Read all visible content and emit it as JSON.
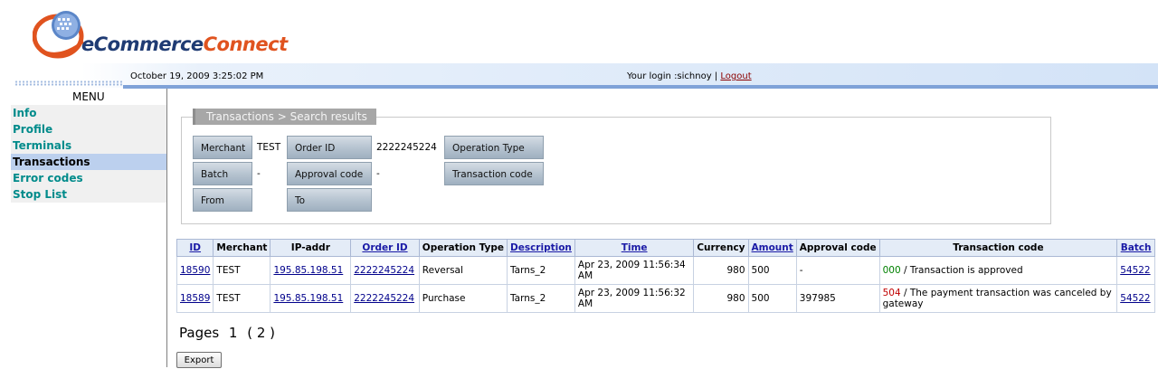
{
  "header": {
    "logo_part1": "eCommerce",
    "logo_part2": "Connect",
    "date": "October 19, 2009 3:25:02 PM",
    "login_label": "Your login :sichnoy",
    "separator": "|",
    "logout": "Logout"
  },
  "sidebar": {
    "title": "MENU",
    "items": [
      {
        "label": "Info"
      },
      {
        "label": "Profile"
      },
      {
        "label": "Terminals"
      },
      {
        "label": "Transactions"
      },
      {
        "label": "Error codes"
      },
      {
        "label": "Stop List"
      }
    ]
  },
  "search": {
    "legend": "Transactions > Search results",
    "fields": {
      "merchant": {
        "label": "Merchant",
        "value": "TEST"
      },
      "order_id": {
        "label": "Order ID",
        "value": "2222245224"
      },
      "operation_type": {
        "label": "Operation Type",
        "value": ""
      },
      "batch": {
        "label": "Batch",
        "value": "-"
      },
      "approval_code": {
        "label": "Approval code",
        "value": "-"
      },
      "transaction_code": {
        "label": "Transaction code",
        "value": ""
      },
      "from": {
        "label": "From",
        "value": ""
      },
      "to": {
        "label": "To",
        "value": ""
      }
    }
  },
  "table": {
    "headers": [
      "ID",
      "Merchant",
      "IP-addr",
      "Order ID",
      "Operation Type",
      "Description",
      "Time",
      "Currency",
      "Amount",
      "Approval code",
      "Transaction code",
      "Batch"
    ],
    "rows": [
      {
        "id": "18590",
        "merchant": "TEST",
        "ip": "195.85.198.51",
        "order_id": "2222245224",
        "operation_type": "Reversal",
        "description": "Tarns_2",
        "time": "Apr 23, 2009 11:56:34 AM",
        "currency": "980",
        "amount": "500",
        "approval_code": "-",
        "tx_code": "000",
        "tx_text": "/ Transaction is approved",
        "batch": "54522"
      },
      {
        "id": "18589",
        "merchant": "TEST",
        "ip": "195.85.198.51",
        "order_id": "2222245224",
        "operation_type": "Purchase",
        "description": "Tarns_2",
        "time": "Apr 23, 2009 11:56:32 AM",
        "currency": "980",
        "amount": "500",
        "approval_code": "397985",
        "tx_code": "504",
        "tx_text": "/ The payment transaction was canceled by gateway",
        "batch": "54522"
      }
    ]
  },
  "pager": {
    "label": "Pages",
    "current": "1",
    "other": "( 2 )"
  },
  "export_label": "Export",
  "colors": {
    "accent": "#bcd0ee",
    "menu_link": "#008b8b",
    "ok_code": "#008000",
    "error_code": "#c00000",
    "brand_orange": "#e0531f",
    "brand_navy": "#1f3b73"
  }
}
